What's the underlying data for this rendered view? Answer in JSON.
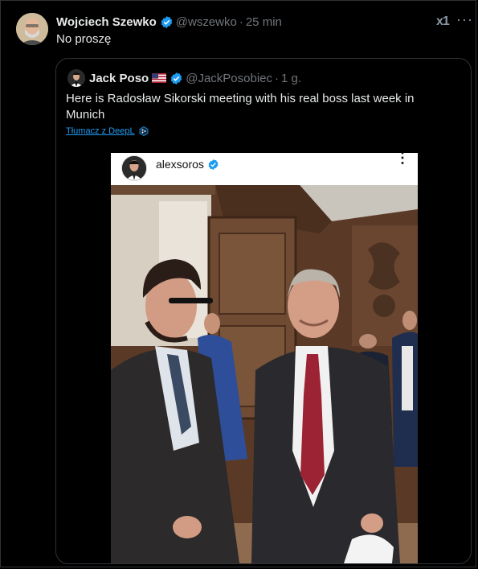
{
  "tweet": {
    "author_name": "Wojciech Szewko",
    "handle": "@wszewko",
    "separator": "·",
    "time": "25 min",
    "text": "No proszę",
    "grok_label": "x1",
    "more_label": "···"
  },
  "quote": {
    "author_name": "Jack Poso",
    "handle": "@JackPosobiec",
    "separator": "·",
    "time": "1 g.",
    "text": "Here is Radosław Sikorski meeting with his real boss last week in Munich",
    "translate_label": "Tłumacz z DeepL"
  },
  "embed": {
    "account_name": "alexsoros",
    "more_label": "⋮"
  },
  "colors": {
    "background": "#000000",
    "text": "#e7e9ea",
    "muted": "#71767b",
    "verified": "#1d9bf0",
    "link": "#1d9bf0"
  }
}
